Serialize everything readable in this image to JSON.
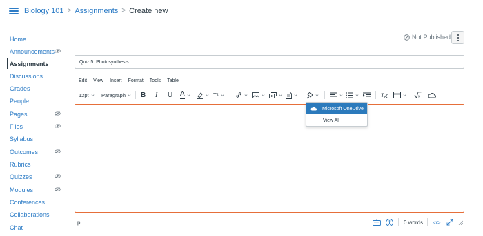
{
  "breadcrumb": {
    "course": "Biology 101",
    "section": "Assignments",
    "current": "Create new",
    "separator": ">"
  },
  "sidebar": {
    "items": [
      {
        "label": "Home",
        "active": false,
        "hidden_icon": false
      },
      {
        "label": "Announcements",
        "active": false,
        "hidden_icon": true
      },
      {
        "label": "Assignments",
        "active": true,
        "hidden_icon": false
      },
      {
        "label": "Discussions",
        "active": false,
        "hidden_icon": false
      },
      {
        "label": "Grades",
        "active": false,
        "hidden_icon": false
      },
      {
        "label": "People",
        "active": false,
        "hidden_icon": false
      },
      {
        "label": "Pages",
        "active": false,
        "hidden_icon": true
      },
      {
        "label": "Files",
        "active": false,
        "hidden_icon": true
      },
      {
        "label": "Syllabus",
        "active": false,
        "hidden_icon": false
      },
      {
        "label": "Outcomes",
        "active": false,
        "hidden_icon": true
      },
      {
        "label": "Rubrics",
        "active": false,
        "hidden_icon": false
      },
      {
        "label": "Quizzes",
        "active": false,
        "hidden_icon": true
      },
      {
        "label": "Modules",
        "active": false,
        "hidden_icon": true
      },
      {
        "label": "Conferences",
        "active": false,
        "hidden_icon": false
      },
      {
        "label": "Collaborations",
        "active": false,
        "hidden_icon": false
      },
      {
        "label": "Chat",
        "active": false,
        "hidden_icon": false
      }
    ]
  },
  "publish_status": "Not Published",
  "assignment": {
    "title_value": "Quiz 5: Photosynthesis"
  },
  "editor": {
    "menu": [
      "Edit",
      "View",
      "Insert",
      "Format",
      "Tools",
      "Table"
    ],
    "font_size": "12pt",
    "block_format": "Paragraph",
    "bold_glyph": "B",
    "italic_glyph": "I",
    "underline_glyph": "U",
    "text_color_glyph": "A",
    "superscript_glyph": "T²",
    "element_path": "p",
    "word_count": "0 words",
    "html_toggle": "</>"
  },
  "dropdown": {
    "items": [
      "Microsoft OneDrive",
      "View All"
    ]
  },
  "colors": {
    "link": "#2d7cc6",
    "text": "#2d3b45",
    "editor_focus_border": "#e66f3a",
    "dropdown_highlight": "#2b7abc"
  },
  "icons": [
    "hamburger-icon",
    "hidden-eye-icon",
    "not-published-icon",
    "kebab-menu-icon",
    "chevron-down-icon",
    "text-color-icon",
    "highlight-icon",
    "superscript-icon",
    "link-icon",
    "image-icon",
    "media-icon",
    "document-icon",
    "apps-plug-icon",
    "align-icon",
    "list-icon",
    "indent-icon",
    "clear-format-icon",
    "table-icon",
    "equation-icon",
    "cloud-icon",
    "keyboard-icon",
    "accessibility-icon",
    "fullscreen-icon"
  ]
}
